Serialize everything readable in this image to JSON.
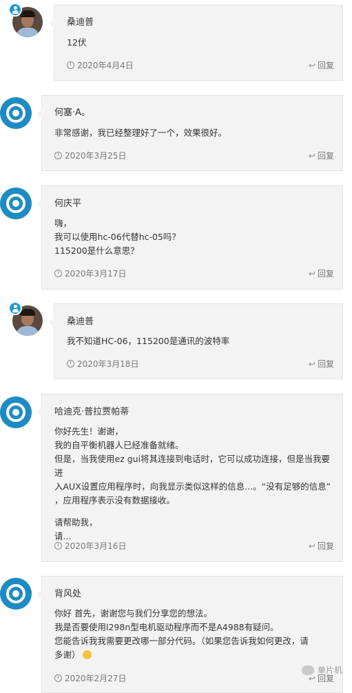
{
  "comments": [
    {
      "author": "桑迪普",
      "lines": [
        "12伏"
      ],
      "date": "2020年4月4日",
      "reply": "回复",
      "avatar": "author-photo",
      "is_post_author": true
    },
    {
      "author": "何塞·A。",
      "lines": [
        "非常感谢，我已经整理好了一个，效果很好。"
      ],
      "date": "2020年3月25日",
      "reply": "回复",
      "avatar": "default-logo"
    },
    {
      "author": "何庆平",
      "lines": [
        "嗨，",
        "我可以使用hc-06代替hc-05吗？",
        "115200是什么意思？"
      ],
      "date": "2020年3月17日",
      "reply": "回复",
      "avatar": "default-logo"
    },
    {
      "author": "桑迪普",
      "lines": [
        "我不知道HC-06，115200是通讯的波特率"
      ],
      "date": "2020年3月18日",
      "reply": "回复",
      "avatar": "author-photo",
      "is_post_author": true
    },
    {
      "author": "哈迪克·普拉贾帕蒂",
      "lines": [
        "你好先生！谢谢，",
        "我的自平衡机器人已经准备就绪。",
        "但是，当我使用ez gui将其连接到电话时，它可以成功连接，但是当我要进",
        "入AUX设置应用程序时，向我显示类似这样的信息...。“没有足够的信息”",
        "，应用程序表示没有数据接收。",
        "请帮助我，",
        "请..."
      ],
      "date": "2020年3月16日",
      "reply": "回复",
      "avatar": "default-logo"
    },
    {
      "author": "背风处",
      "lines": [
        "你好 首先，谢谢您与我们分享您的想法。",
        "我是否要使用l298n型电机驱动程序而不是A4988有疑问。",
        "您能告诉我我需要更改哪一部分代码。（如果您告诉我如何更改，请",
        "多谢）"
      ],
      "date": "2020年2月27日",
      "reply": "回复",
      "avatar": "default-logo"
    }
  ],
  "watermark": "单片机",
  "icons": {
    "date": "clock-icon",
    "reply": "reply-arrow-icon",
    "badge": "user-icon",
    "emoji": "smile-emoji-icon"
  },
  "colors": {
    "card_bg": "#f3f3f3",
    "accent": "#1e8bc3",
    "meta": "#777777"
  }
}
